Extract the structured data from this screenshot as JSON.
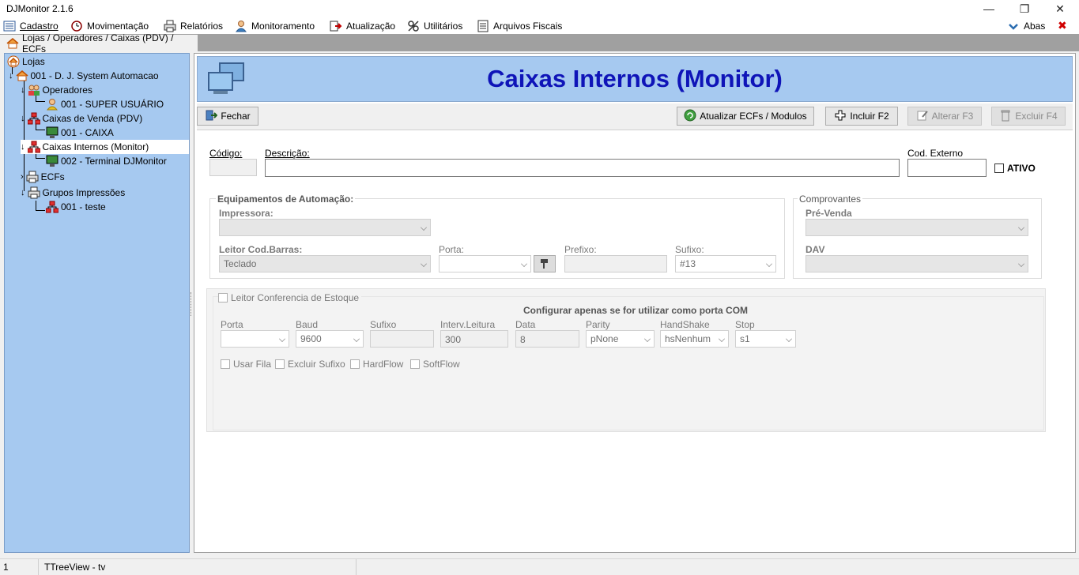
{
  "window": {
    "title": "DJMonitor 2.1.6",
    "minimize": "—",
    "maximize": "❐",
    "close": "✕"
  },
  "menu": {
    "items": [
      "Cadastro",
      "Movimentação",
      "Relatórios",
      "Monitoramento",
      "Atualização",
      "Utilitários",
      "Arquivos Fiscais"
    ],
    "abas_label": "Abas",
    "abas_close": "✖"
  },
  "path_tab": {
    "label": "Lojas / Operadores / Caixas (PDV) / ECFs"
  },
  "tree": {
    "root": "Lojas",
    "store": "001 - D. J. System Automacao",
    "operadores": "Operadores",
    "operador_1": "001 - SUPER USUÁRIO",
    "caixas_venda": "Caixas de Venda (PDV)",
    "caixa_1": "001 - CAIXA",
    "caixas_internos": "Caixas Internos (Monitor)",
    "terminal_1": "002 - Terminal DJMonitor",
    "ecfs": "ECFs",
    "grupos": "Grupos Impressões",
    "grupo_1": "001 - teste"
  },
  "header": {
    "title": "Caixas Internos (Monitor)"
  },
  "toolbar": {
    "fechar": "Fechar",
    "atualizar": "Atualizar ECFs / Modulos",
    "incluir": "Incluir F2",
    "alterar": "Alterar F3",
    "excluir": "Excluir F4"
  },
  "form": {
    "codigo_label": "Código:",
    "codigo_value": "",
    "descricao_label": "Descrição:",
    "descricao_value": "",
    "cod_externo_label": "Cod. Externo",
    "cod_externo_value": "",
    "ativo_label": "ATIVO"
  },
  "equipamentos": {
    "group_label": "Equipamentos de Automação:",
    "impressora_label": "Impressora:",
    "impressora_value": "",
    "leitor_label": "Leitor Cod.Barras:",
    "leitor_value": "Teclado",
    "porta_label": "Porta:",
    "porta_value": "",
    "prefixo_label": "Prefixo:",
    "prefixo_value": "",
    "sufixo_label": "Sufixo:",
    "sufixo_value": "#13"
  },
  "comprovantes": {
    "group_label": "Comprovantes",
    "pre_venda_label": "Pré-Venda",
    "pre_venda_value": "",
    "dav_label": "DAV",
    "dav_value": ""
  },
  "leitor_conferencia": {
    "checkbox_label": "Leitor Conferencia de Estoque",
    "note": "Configurar apenas se for utilizar como porta COM",
    "porta_label": "Porta",
    "porta_value": "",
    "baud_label": "Baud",
    "baud_value": "9600",
    "sufixo_label": "Sufixo",
    "sufixo_value": "",
    "interv_label": "Interv.Leitura",
    "interv_value": "300",
    "data_label": "Data",
    "data_value": "8",
    "parity_label": "Parity",
    "parity_value": "pNone",
    "handshake_label": "HandShake",
    "handshake_value": "hsNenhum",
    "stop_label": "Stop",
    "stop_value": "s1",
    "usar_fila": "Usar Fila",
    "excluir_sufixo": "Excluir Sufixo",
    "hardflow": "HardFlow",
    "softflow": "SoftFlow"
  },
  "status": {
    "left": "1",
    "right": "TTreeView - tv"
  }
}
